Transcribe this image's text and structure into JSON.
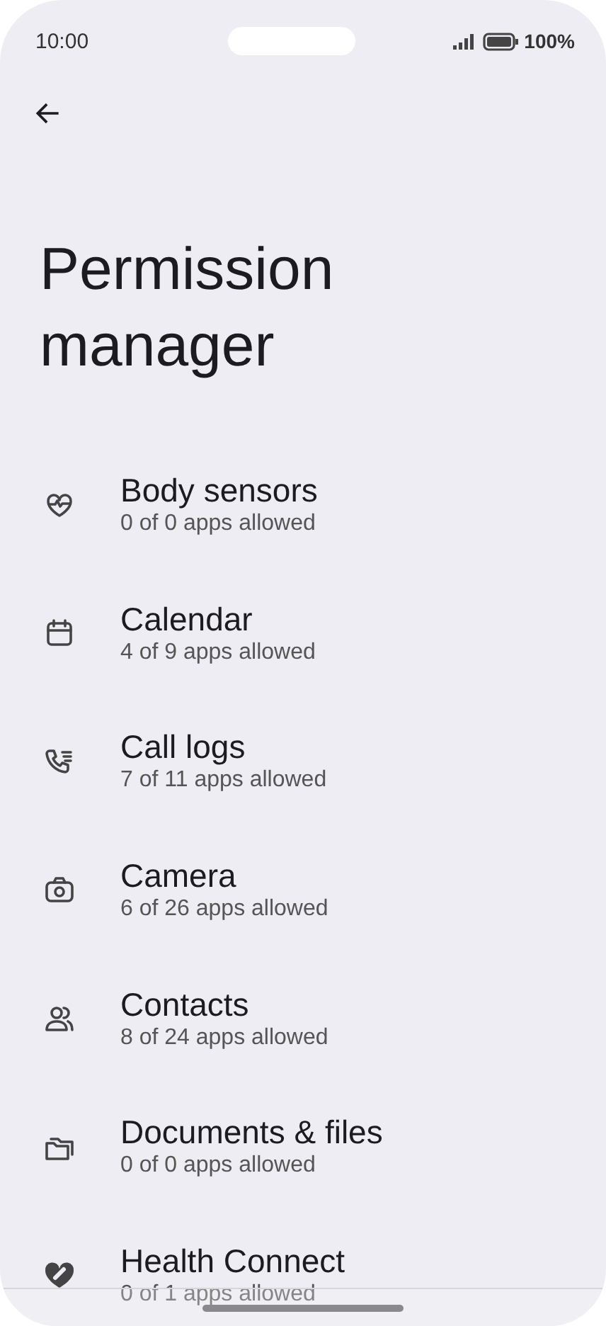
{
  "status_bar": {
    "time": "10:00",
    "battery": "100%"
  },
  "title": "Permission manager",
  "permissions": [
    {
      "kind": "body-sensors",
      "label": "Body sensors",
      "summary": "0 of 0 apps allowed"
    },
    {
      "kind": "calendar",
      "label": "Calendar",
      "summary": "4 of 9 apps allowed"
    },
    {
      "kind": "call-logs",
      "label": "Call logs",
      "summary": "7 of 11 apps allowed"
    },
    {
      "kind": "camera",
      "label": "Camera",
      "summary": "6 of 26 apps allowed"
    },
    {
      "kind": "contacts",
      "label": "Contacts",
      "summary": "8 of 24 apps allowed"
    },
    {
      "kind": "files",
      "label": "Documents & files",
      "summary": "0 of 0 apps allowed"
    },
    {
      "kind": "health",
      "label": "Health Connect",
      "summary": "0 of 1 apps allowed"
    }
  ]
}
